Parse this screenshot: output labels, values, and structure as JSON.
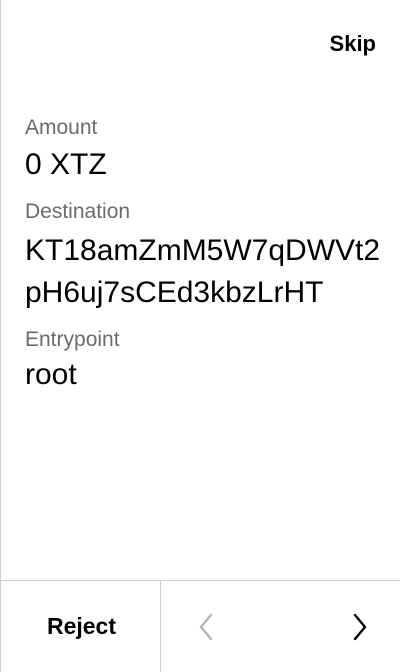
{
  "header": {
    "skip_label": "Skip"
  },
  "fields": {
    "amount": {
      "label": "Amount",
      "value": "0 XTZ"
    },
    "destination": {
      "label": "Destination",
      "value": "KT18amZmM5W7qDWVt2pH6uj7sCEd3kbzLrHT"
    },
    "entrypoint": {
      "label": "Entrypoint",
      "value": "root"
    }
  },
  "footer": {
    "reject_label": "Reject",
    "prev_icon": "chevron-left-icon",
    "next_icon": "chevron-right-icon"
  },
  "colors": {
    "label": "#6b6b6b",
    "disabled_icon": "#b5b5b5",
    "divider": "#cfcfcf"
  }
}
